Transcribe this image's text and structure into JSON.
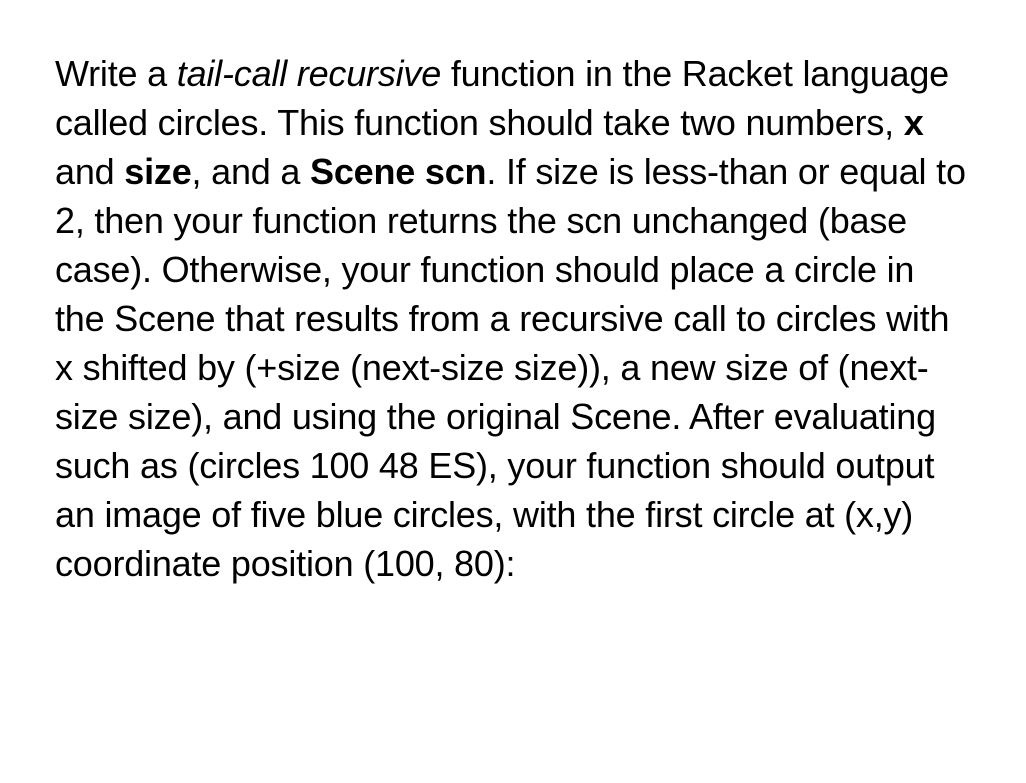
{
  "text": {
    "t1": "Write a ",
    "t2": "tail-call recursive",
    "t3": " function in the Racket language called circles.  This function should take two numbers, ",
    "t4": "x",
    "t5": " and ",
    "t6": "size",
    "t7": ", and a ",
    "t8": "Scene scn",
    "t9": ".  If size is less-than or equal to 2, then your function returns the scn unchanged (base case).  Otherwise, your function should place a circle in the Scene that results from a recursive call to circles with x shifted by (+size (next-size size)), a new size of (next-size size), and using the original Scene.  After evaluating such as (circles 100 48 ES), your function should output an image of five blue circles, with the first circle at (x,y) coordinate position (100, 80):"
  }
}
